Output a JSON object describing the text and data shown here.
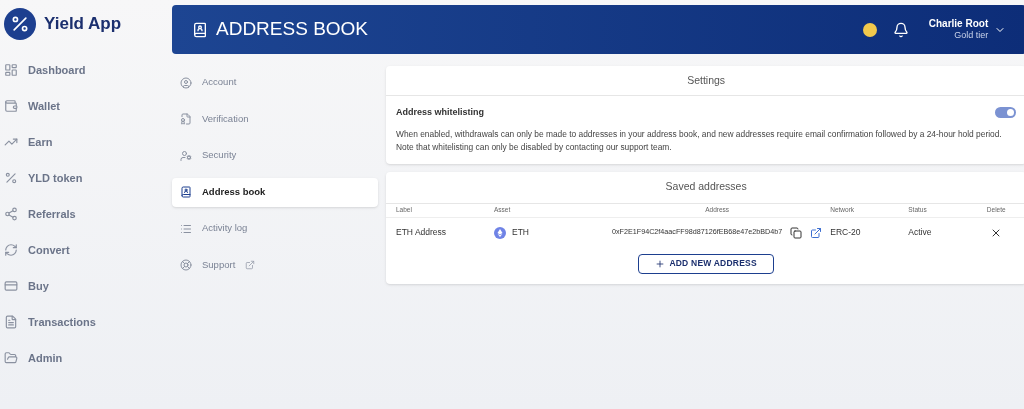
{
  "brand": {
    "name": "Yield App"
  },
  "sidebar": {
    "items": [
      {
        "label": "Dashboard",
        "selected": false
      },
      {
        "label": "Wallet",
        "selected": false
      },
      {
        "label": "Earn",
        "selected": false
      },
      {
        "label": "YLD token",
        "selected": false
      },
      {
        "label": "Referrals",
        "selected": false
      },
      {
        "label": "Convert",
        "selected": false
      },
      {
        "label": "Buy",
        "selected": false
      },
      {
        "label": "Transactions",
        "selected": false
      },
      {
        "label": "Admin",
        "selected": false
      }
    ]
  },
  "header": {
    "title": "ADDRESS BOOK",
    "user": {
      "name": "Charlie Root",
      "tier": "Gold tier"
    }
  },
  "settings_nav": {
    "items": [
      {
        "label": "Account",
        "selected": false,
        "external": false
      },
      {
        "label": "Verification",
        "selected": false,
        "external": false
      },
      {
        "label": "Security",
        "selected": false,
        "external": false
      },
      {
        "label": "Address book",
        "selected": true,
        "external": false
      },
      {
        "label": "Activity log",
        "selected": false,
        "external": false
      },
      {
        "label": "Support",
        "selected": false,
        "external": true
      }
    ]
  },
  "settings": {
    "title": "Settings",
    "whitelisting": {
      "label": "Address whitelisting",
      "on": true,
      "description": "When enabled, withdrawals can only be made to addresses in your address book, and new addresses require email confirmation followed by a 24-hour hold period. Note that whitelisting can only be disabled by contacting our support team."
    }
  },
  "saved_addresses": {
    "title": "Saved addresses",
    "columns": [
      "Label",
      "Asset",
      "Address",
      "Network",
      "Status",
      "Delete"
    ],
    "rows": [
      {
        "label": "ETH Address",
        "asset": "ETH",
        "address": "0xF2E1F94C2f4aacFF98d87126fEB68e47e2bBD4b7",
        "network": "ERC-20",
        "status": "Active"
      }
    ],
    "add_button": "ADD NEW ADDRESS"
  }
}
